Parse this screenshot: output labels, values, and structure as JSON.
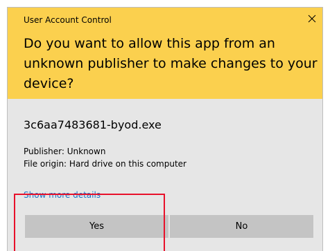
{
  "dialog": {
    "window_title": "User Account Control",
    "question": "Do you want to allow this app from an unknown publisher to make changes to your device?",
    "app_name": "3c6aa7483681-byod.exe",
    "publisher": "Publisher: Unknown",
    "file_origin": "File origin: Hard drive on this computer",
    "details_link": "Show more details",
    "close_icon": "close-icon",
    "yes_label": "Yes",
    "no_label": "No"
  },
  "colors": {
    "header_bg": "#fbd04e",
    "body_bg": "#e6e6e6",
    "button_bg": "#c4c4c4",
    "link": "#1a73c8",
    "highlight_border": "#e8102a"
  }
}
